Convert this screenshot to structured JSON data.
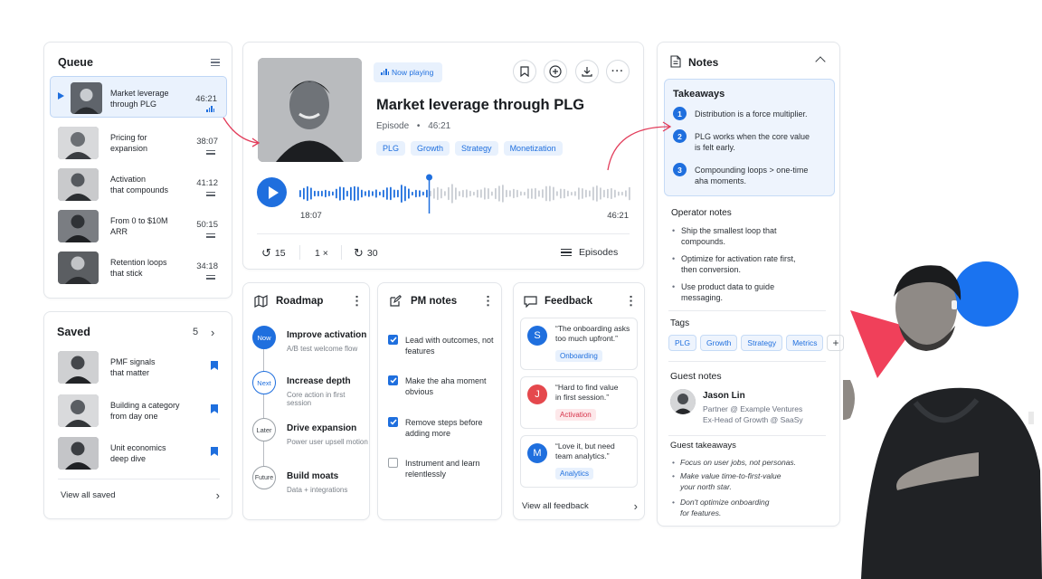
{
  "queue": {
    "title": "Queue",
    "items": [
      {
        "title_l1": "Market leverage",
        "title_l2": "through PLG",
        "duration": "46:21",
        "active": true
      },
      {
        "title_l1": "Pricing for",
        "title_l2": "expansion",
        "duration": "38:07"
      },
      {
        "title_l1": "Activation",
        "title_l2": "that compounds",
        "duration": "41:12"
      },
      {
        "title_l1": "From 0 to $10M",
        "title_l2": "ARR",
        "duration": "50:15"
      },
      {
        "title_l1": "Retention loops",
        "title_l2": "that stick",
        "duration": "34:18"
      }
    ]
  },
  "saved": {
    "title": "Saved",
    "count": "5",
    "items": [
      {
        "title_l1": "PMF signals",
        "title_l2": "that matter"
      },
      {
        "title_l1": "Building a category",
        "title_l2": "from day one"
      },
      {
        "title_l1": "Unit economics",
        "title_l2": "deep dive"
      }
    ],
    "view_all": "View all saved"
  },
  "player": {
    "badge": "Now playing",
    "title": "Market leverage through PLG",
    "episode_label": "Episode",
    "separator": "•",
    "duration": "46:21",
    "tags": [
      "PLG",
      "Growth",
      "Strategy",
      "Monetization"
    ],
    "current_time": "18:07",
    "total_time": "46:21",
    "progress": 0.39,
    "skip_back": "15",
    "speed": "1 ×",
    "skip_forward": "30",
    "episodes_label": "Episodes"
  },
  "roadmap": {
    "title": "Roadmap",
    "items": [
      {
        "stage": "Now",
        "title": "Improve activation",
        "sub": "A/B test welcome flow"
      },
      {
        "stage": "Next",
        "title": "Increase depth",
        "sub": "Core action in first session"
      },
      {
        "stage": "Later",
        "title": "Drive expansion",
        "sub": "Power user upsell motion"
      },
      {
        "stage": "Future",
        "title": "Build moats",
        "sub": "Data + integrations"
      }
    ]
  },
  "pm_notes": {
    "title": "PM notes",
    "items": [
      {
        "l1": "Lead with outcomes, not",
        "l2": "features",
        "checked": true
      },
      {
        "l1": "Make the aha moment",
        "l2": "obvious",
        "checked": true
      },
      {
        "l1": "Remove steps before",
        "l2": "adding more",
        "checked": true
      },
      {
        "l1": "Instrument and learn",
        "l2": "relentlessly",
        "checked": false
      }
    ]
  },
  "feedback": {
    "title": "Feedback",
    "items": [
      {
        "initial": "S",
        "l1": "“The onboarding asks",
        "l2": "too much upfront.”",
        "tag": "Onboarding",
        "color": "#1f6fde",
        "tag_bg": "#e8f1fd",
        "tag_fg": "#1f6fde"
      },
      {
        "initial": "J",
        "l1": "“Hard to find value",
        "l2": "in first session.”",
        "tag": "Activation",
        "color": "#e5484d",
        "tag_bg": "#fde8ea",
        "tag_fg": "#d6334a"
      },
      {
        "initial": "M",
        "l1": "“Love it, but need",
        "l2": "team analytics.”",
        "tag": "Analytics",
        "color": "#1f6fde",
        "tag_bg": "#e8f1fd",
        "tag_fg": "#1f6fde"
      }
    ],
    "view_all": "View all feedback"
  },
  "notes": {
    "title": "Notes",
    "takeaways_title": "Takeaways",
    "takeaways": [
      {
        "n": "1",
        "l1": "Distribution is a force multiplier.",
        "l2": ""
      },
      {
        "n": "2",
        "l1": "PLG works when the core value",
        "l2": "is felt early."
      },
      {
        "n": "3",
        "l1": "Compounding loops > one-time",
        "l2": "aha moments."
      }
    ],
    "operator_title": "Operator notes",
    "operator": [
      {
        "l1": "Ship the smallest loop that",
        "l2": "compounds."
      },
      {
        "l1": "Optimize for activation rate first,",
        "l2": "then conversion."
      },
      {
        "l1": "Use product data to guide",
        "l2": "messaging."
      }
    ],
    "tags_title": "Tags",
    "tags": [
      "PLG",
      "Growth",
      "Strategy",
      "Metrics"
    ],
    "add_tag": "+",
    "guest_notes_title": "Guest notes",
    "guest": {
      "name": "Jason Lin",
      "role1": "Partner @ Example Ventures",
      "role2": "Ex-Head of Growth @ SaaSy"
    },
    "guest_takeaways_title": "Guest takeaways",
    "guest_takeaways": [
      {
        "l1": "Focus on user jobs, not personas.",
        "l2": ""
      },
      {
        "l1": "Make value time-to-first-value",
        "l2": "your north star."
      },
      {
        "l1": "Don't optimize onboarding",
        "l2": "for features."
      }
    ]
  },
  "colors": {
    "accent": "#1f6fde",
    "accent_soft": "#e8f1fd",
    "annotation": "#e23c5a",
    "deco_red": "#f0405a",
    "deco_blue": "#1a73f0"
  }
}
